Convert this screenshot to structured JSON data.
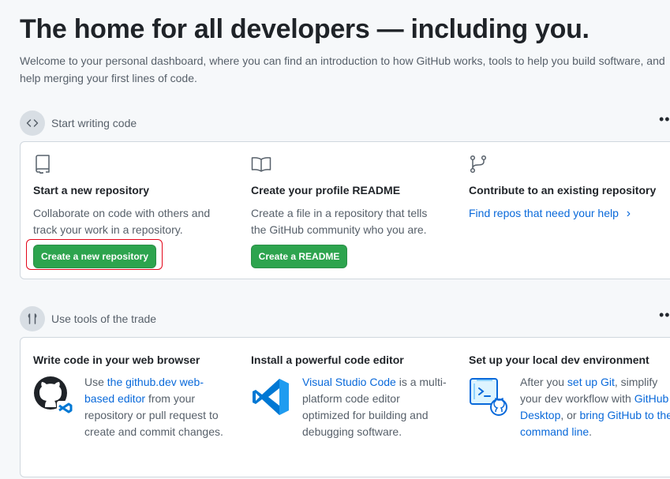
{
  "hero": {
    "title": "The home for all developers — including you.",
    "description": "Welcome to your personal dashboard, where you can find an introduction to how GitHub works, tools to help you build software, and help merging your first lines of code."
  },
  "section_code": {
    "label": "Start writing code",
    "menu_label": "•••",
    "cards": [
      {
        "title": "Start a new repository",
        "text": "Collaborate on code with others and track your work in a repository.",
        "button": "Create a new repository"
      },
      {
        "title": "Create your profile README",
        "text": "Create a file in a repository that tells the GitHub community who you are.",
        "button": "Create a README"
      },
      {
        "title": "Contribute to an existing repository",
        "link": "Find repos that need your help",
        "link_chevron": "›"
      }
    ]
  },
  "section_tools": {
    "label": "Use tools of the trade",
    "menu_label": "•••",
    "cards": [
      {
        "title": "Write code in your web browser",
        "t1": "Use ",
        "l1": "the github.dev web-based editor",
        "t2": " from your repository or pull request to create and commit changes."
      },
      {
        "title": "Install a powerful code editor",
        "l1": "Visual Studio Code",
        "t1": " is a multi-platform code editor optimized for building and debugging software."
      },
      {
        "title": "Set up your local dev environment",
        "t1": "After you ",
        "l1": "set up Git",
        "t2": ", simplify your dev workflow with ",
        "l2": "GitHub Desktop",
        "t3": ", or ",
        "l3": "bring GitHub to the command line",
        "t4": "."
      }
    ]
  },
  "colors": {
    "accent_green": "#2da44e",
    "link_blue": "#0969da",
    "highlight_red": "#e3061a"
  }
}
